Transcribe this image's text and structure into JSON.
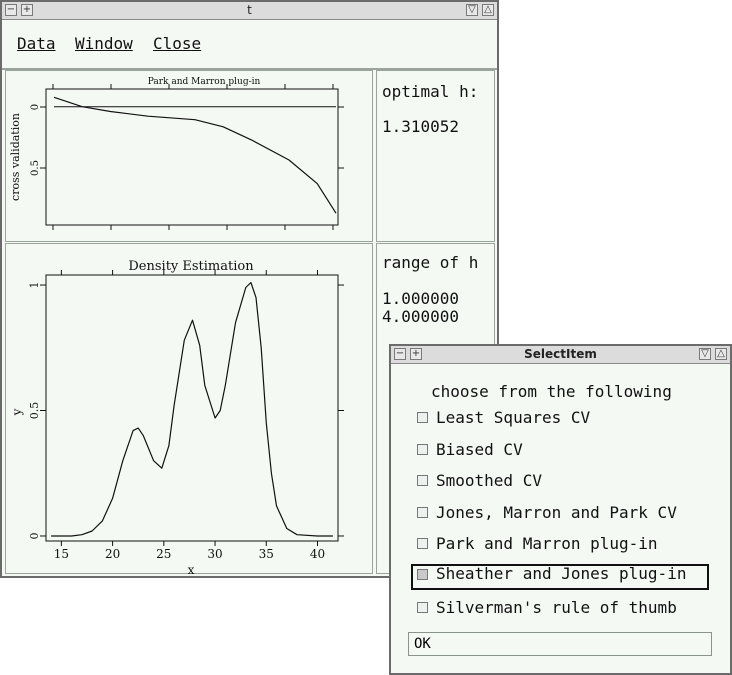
{
  "main_window": {
    "title": "t",
    "menu": [
      {
        "label": "Data"
      },
      {
        "label": "Window"
      },
      {
        "label": "Close"
      }
    ]
  },
  "cv_plot": {
    "title": "Park and Marron plug-in",
    "ylabel": "cross validation",
    "yticks": [
      "0",
      "0.5"
    ]
  },
  "density_plot": {
    "title": "Density Estimation",
    "xlabel": "x",
    "ylabel": "y",
    "xticks": [
      "15",
      "20",
      "25",
      "30",
      "35",
      "40"
    ],
    "yticks": [
      "0",
      "0.5",
      "1"
    ]
  },
  "optimal_panel": {
    "label": "optimal h:",
    "value": "1.310052"
  },
  "range_panel": {
    "label": "range of h",
    "min": "1.000000",
    "max": "4.000000"
  },
  "dialog": {
    "title": "SelectItem",
    "prompt": "choose from the following",
    "options": [
      {
        "label": "Least Squares CV",
        "selected": false
      },
      {
        "label": "Biased CV",
        "selected": false
      },
      {
        "label": "Smoothed CV",
        "selected": false
      },
      {
        "label": "Jones, Marron and Park CV",
        "selected": false
      },
      {
        "label": "Park and Marron plug-in",
        "selected": false
      },
      {
        "label": "Sheather and Jones plug-in",
        "selected": true
      },
      {
        "label": "Silverman's rule of thumb",
        "selected": false
      }
    ],
    "ok_label": "OK"
  },
  "chart_data": [
    {
      "type": "line",
      "title": "Park and Marron plug-in",
      "ylabel": "cross validation",
      "x": [
        1.0,
        1.3,
        1.6,
        2.0,
        2.5,
        2.8,
        3.1,
        3.5,
        3.8,
        4.0
      ],
      "series": [
        {
          "values": [
            -0.08,
            0.0,
            0.04,
            0.08,
            0.11,
            0.17,
            0.28,
            0.45,
            0.65,
            0.9
          ]
        }
      ],
      "reference_line_y": 0,
      "ylim": [
        1.0,
        -0.15
      ],
      "xlim": [
        1.0,
        4.0
      ]
    },
    {
      "type": "line",
      "title": "Density Estimation",
      "xlabel": "x",
      "ylabel": "y",
      "x": [
        14.0,
        16.0,
        17.0,
        18.0,
        19.0,
        20.0,
        21.0,
        22.0,
        22.5,
        23.0,
        24.0,
        24.8,
        25.5,
        26.0,
        27.0,
        27.8,
        28.5,
        29.0,
        30.0,
        30.5,
        31.0,
        32.0,
        33.0,
        33.5,
        34.0,
        34.5,
        35.0,
        35.5,
        36.0,
        37.0,
        38.0,
        40.0,
        41.5
      ],
      "series": [
        {
          "values": [
            0.0,
            0.0,
            0.005,
            0.02,
            0.06,
            0.15,
            0.3,
            0.42,
            0.43,
            0.4,
            0.3,
            0.27,
            0.36,
            0.52,
            0.78,
            0.86,
            0.76,
            0.6,
            0.47,
            0.5,
            0.6,
            0.85,
            0.99,
            1.01,
            0.95,
            0.75,
            0.45,
            0.25,
            0.12,
            0.03,
            0.005,
            0.0,
            0.0
          ]
        }
      ],
      "xlim": [
        13.5,
        42.0
      ],
      "ylim": [
        -0.02,
        1.04
      ]
    }
  ]
}
